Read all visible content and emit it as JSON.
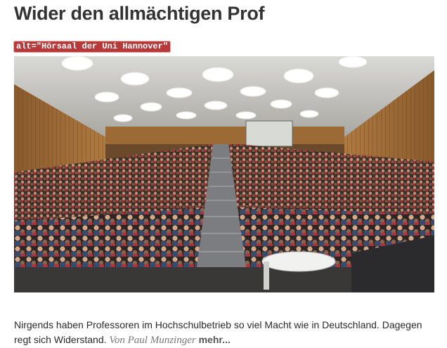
{
  "article": {
    "headline": "Wider den allmächtigen Prof",
    "image_alt_label": "alt=\"Hörsaal der Uni Hannover\"",
    "teaser_text": "Nirgends haben Professoren im Hochschulbetrieb so viel Macht wie in Deutschland. Dagegen regt sich Widerstand.",
    "byline": "Von Paul Munzinger",
    "more_link": "mehr..."
  },
  "colors": {
    "alt_tag_bg": "#b73a3a",
    "headline": "#333333",
    "byline": "#777777"
  }
}
